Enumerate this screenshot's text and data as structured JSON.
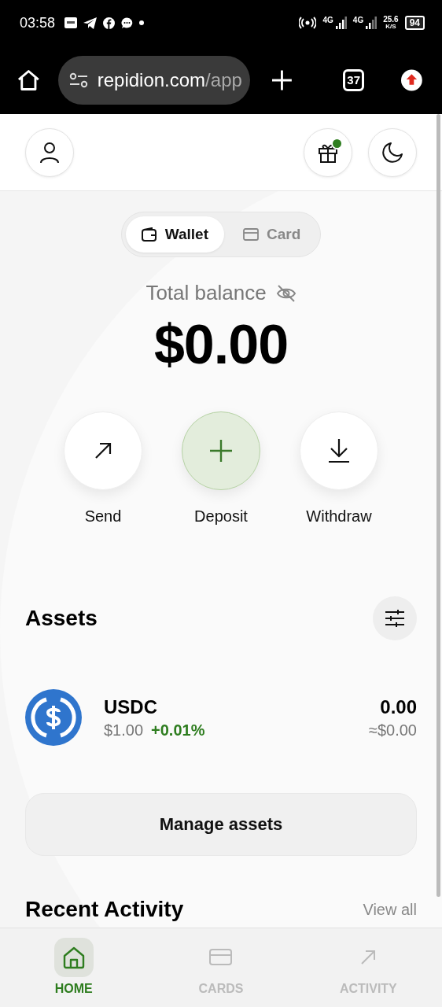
{
  "status_bar": {
    "time": "03:58",
    "network_1": "4G",
    "network_2": "4G",
    "speed": "25.6",
    "speed_unit": "K/S",
    "battery": "94"
  },
  "browser": {
    "url_host": "repidion.com",
    "url_path": "/app",
    "tab_count": "37"
  },
  "header": {
    "gift_badge": true
  },
  "view_switch": [
    {
      "label": "Wallet",
      "kind": "wallet",
      "selected": true
    },
    {
      "label": "Card",
      "kind": "card",
      "selected": false
    }
  ],
  "balance": {
    "label": "Total balance",
    "amount": "$0.00"
  },
  "actions": [
    {
      "label": "Send",
      "kind": "send",
      "primary": false
    },
    {
      "label": "Deposit",
      "kind": "deposit",
      "primary": true
    },
    {
      "label": "Withdraw",
      "kind": "withdraw",
      "primary": false
    }
  ],
  "assets": {
    "title": "Assets",
    "items": [
      {
        "symbol": "USDC",
        "price": "$1.00",
        "change": "+0.01%",
        "amount": "0.00",
        "value": "≈$0.00"
      }
    ],
    "manage_button": "Manage assets"
  },
  "recent_activity": {
    "title": "Recent Activity",
    "link": "View all"
  },
  "bottom_nav": [
    {
      "label": "HOME",
      "kind": "home",
      "selected": true
    },
    {
      "label": "CARDS",
      "kind": "cards",
      "selected": false
    },
    {
      "label": "ACTIVITY",
      "kind": "activity",
      "selected": false
    }
  ]
}
